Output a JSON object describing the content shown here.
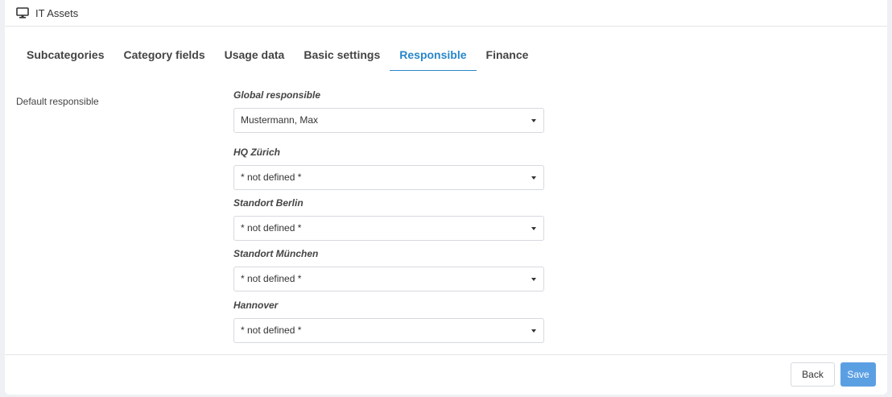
{
  "header": {
    "title": "IT Assets",
    "icon": "monitor-icon"
  },
  "tabs": [
    {
      "label": "Subcategories",
      "active": false
    },
    {
      "label": "Category fields",
      "active": false
    },
    {
      "label": "Usage data",
      "active": false
    },
    {
      "label": "Basic settings",
      "active": false
    },
    {
      "label": "Responsible",
      "active": true
    },
    {
      "label": "Finance",
      "active": false
    }
  ],
  "section": {
    "label": "Default responsible"
  },
  "fields": [
    {
      "label": "Global responsible",
      "value": "Mustermann, Max"
    },
    {
      "label": "HQ Zürich",
      "value": "* not defined *"
    },
    {
      "label": "Standort Berlin",
      "value": "* not defined *"
    },
    {
      "label": "Standort München",
      "value": "* not defined *"
    },
    {
      "label": "Hannover",
      "value": "* not defined *"
    }
  ],
  "footer": {
    "back_label": "Back",
    "save_label": "Save"
  },
  "colors": {
    "accent": "#2a86c9",
    "save_button": "#5b9fe3"
  }
}
